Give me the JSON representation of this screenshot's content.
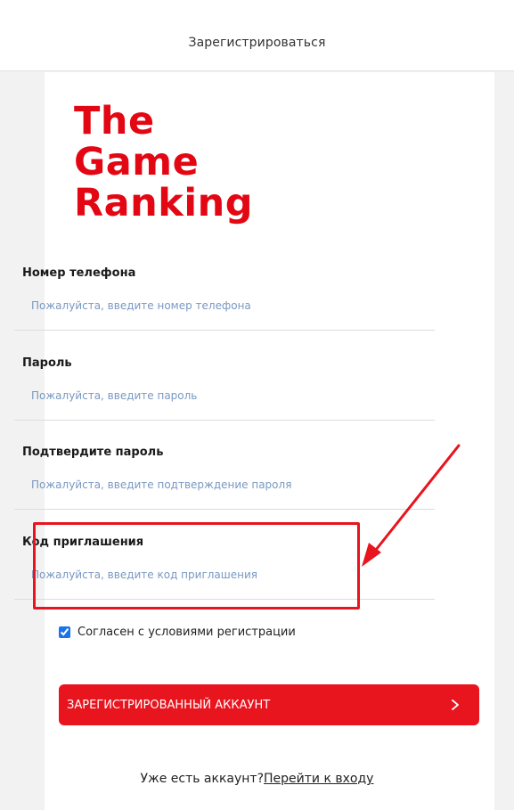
{
  "header": {
    "title": "Зарегистрироваться"
  },
  "logo": {
    "line1": "The",
    "line2": "Game",
    "line3": "Ranking"
  },
  "form": {
    "phone": {
      "label": "Номер телефона",
      "placeholder": "Пожалуйста, введите номер телефона",
      "value": ""
    },
    "password": {
      "label": "Пароль",
      "placeholder": "Пожалуйста, введите пароль",
      "value": ""
    },
    "confirm_password": {
      "label": "Подтвердите пароль",
      "placeholder": "Пожалуйста, введите подтверждение пароля",
      "value": ""
    },
    "invite_code": {
      "label": "Код приглашения",
      "placeholder": "Пожалуйста, введите код приглашения",
      "value": ""
    },
    "agree": {
      "checked": true,
      "label": "Согласен с условиями регистрации"
    },
    "submit_label": "ЗАРЕГИСТРИРОВАННЫЙ АККАУНТ"
  },
  "footer": {
    "prompt": "Уже есть аккаунт?",
    "link_label": "Перейти к входу"
  },
  "colors": {
    "brand_red": "#e30613",
    "button_red": "#e8141e",
    "placeholder_blue": "#7a98c2",
    "annotation_red": "#e8141e"
  }
}
